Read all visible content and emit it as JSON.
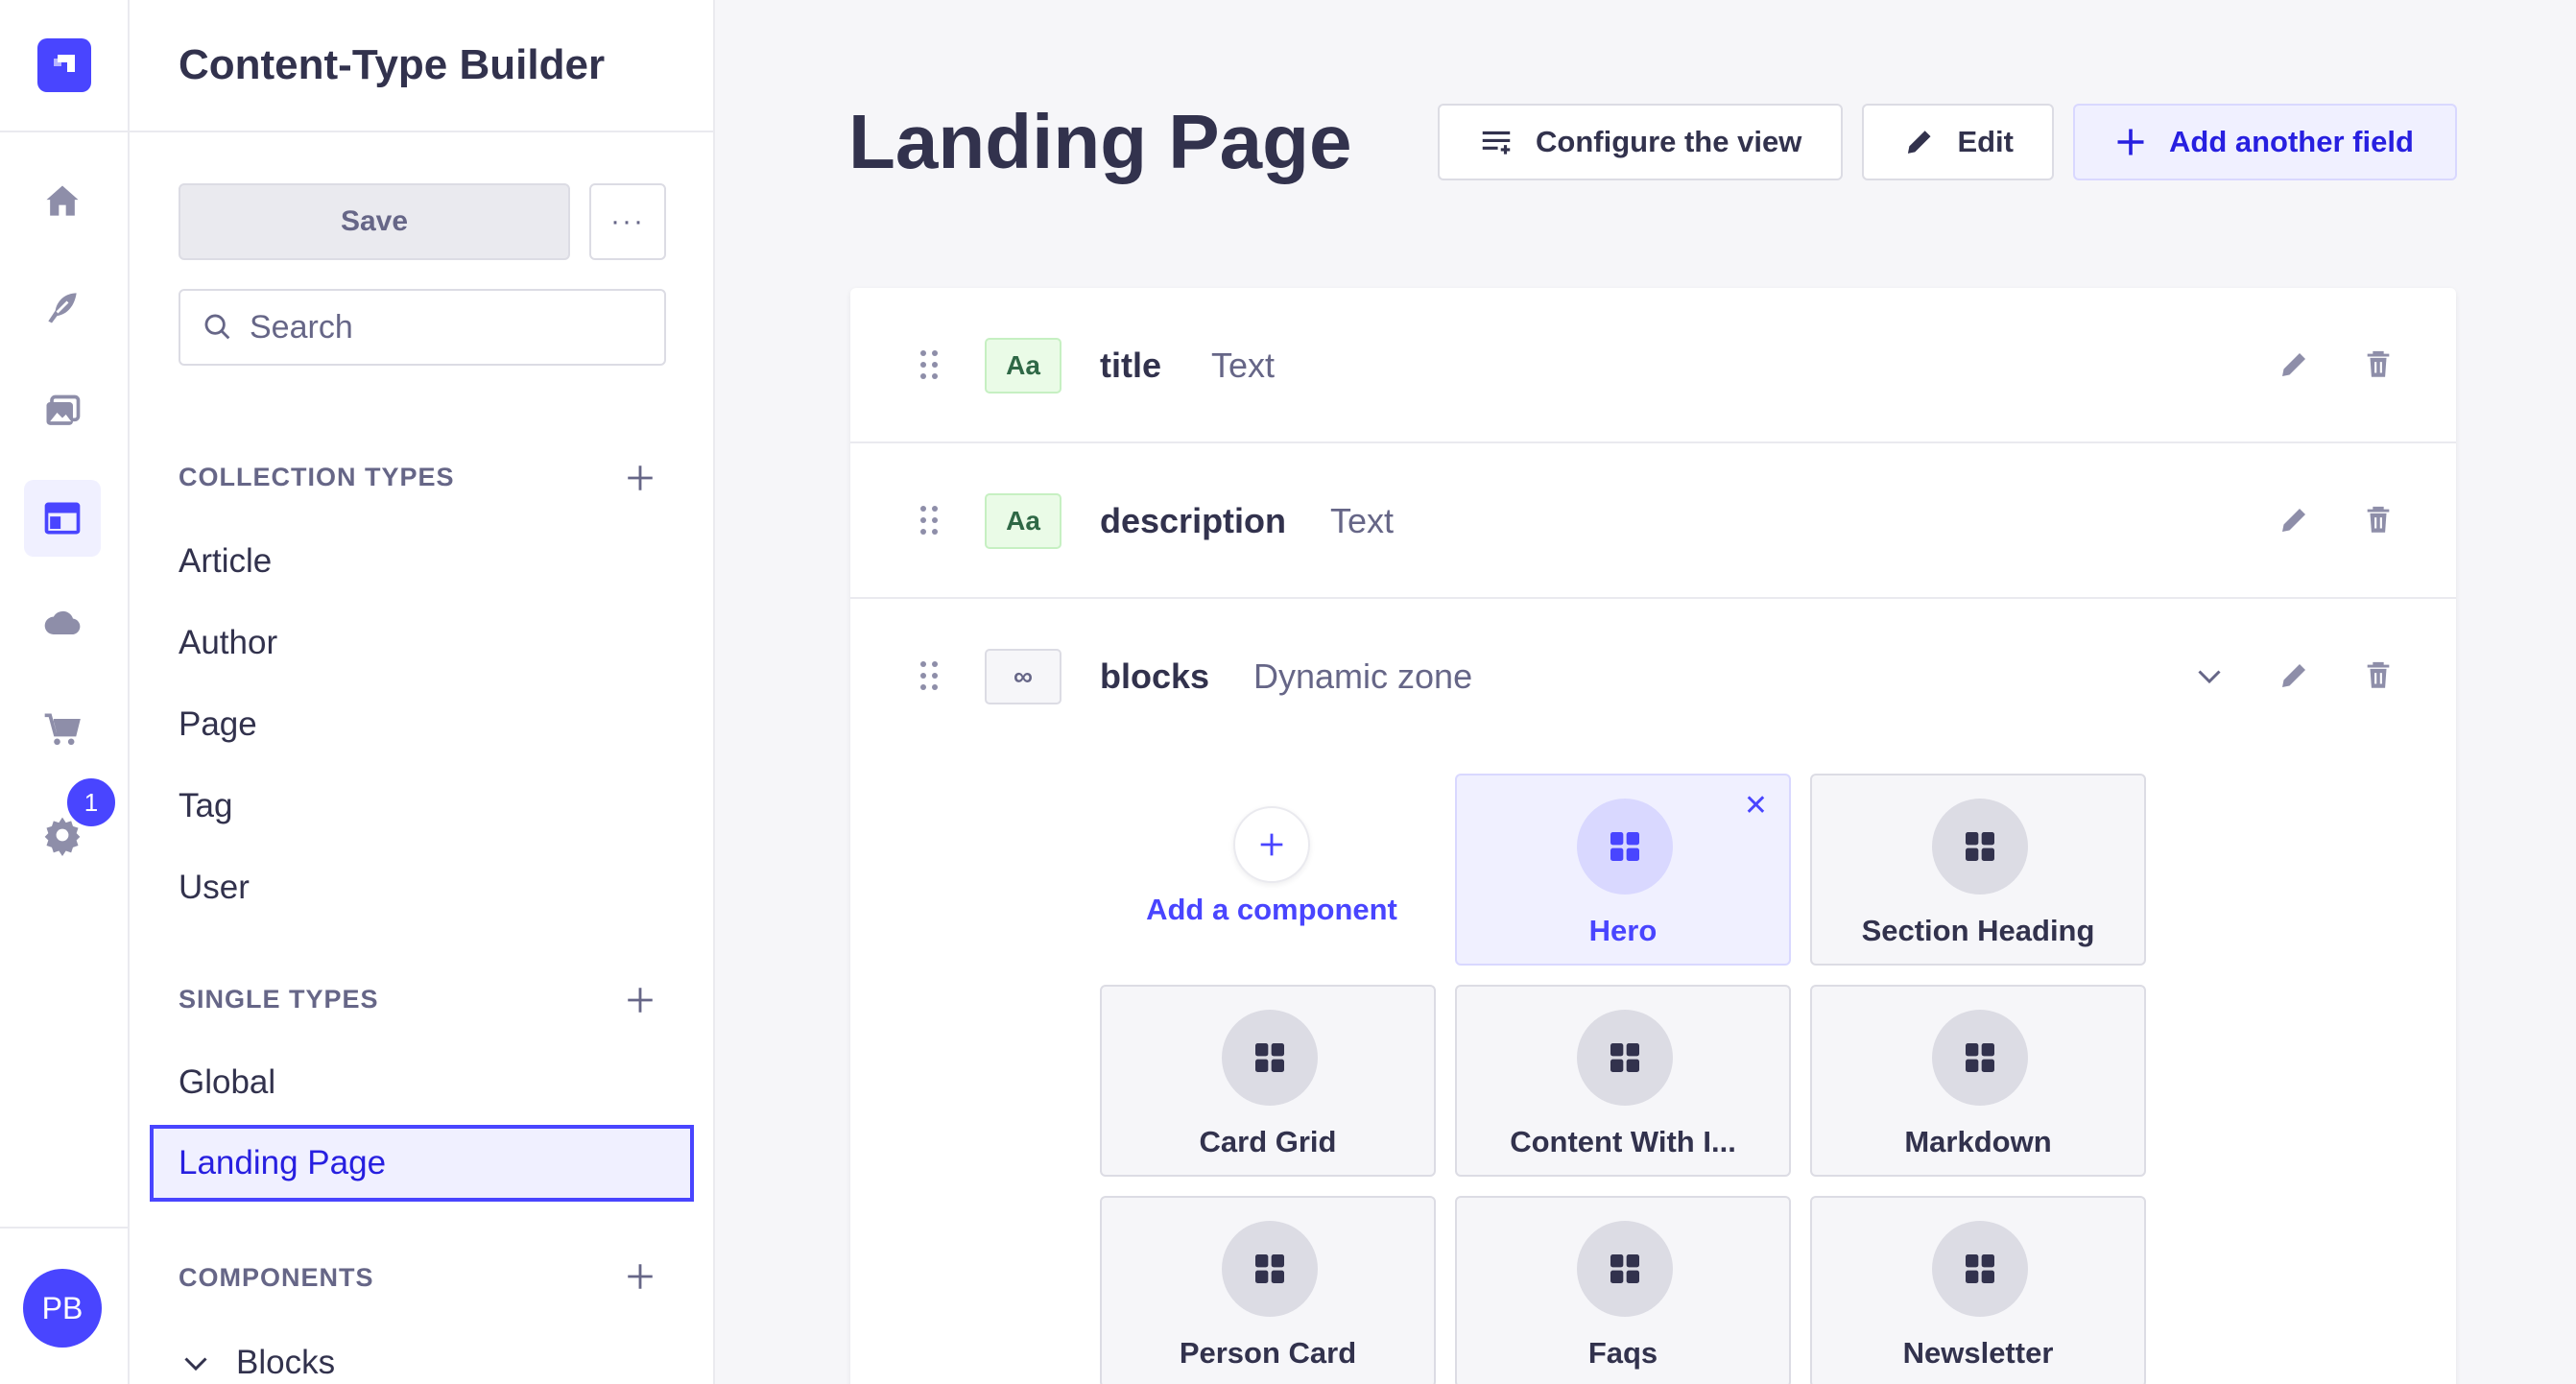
{
  "rail": {
    "badge_count": "1",
    "avatar_initials": "PB",
    "icons": [
      "home-icon",
      "feather-icon",
      "images-icon",
      "layout-icon",
      "cloud-icon",
      "cart-icon",
      "gear-icon"
    ]
  },
  "subnav": {
    "title": "Content-Type Builder",
    "save_label": "Save",
    "more_label": "···",
    "search_placeholder": "Search",
    "collection_types_label": "COLLECTION TYPES",
    "collection_types": [
      "Article",
      "Author",
      "Page",
      "Tag",
      "User"
    ],
    "single_types_label": "SINGLE TYPES",
    "single_types": [
      "Global",
      "Landing Page"
    ],
    "components_label": "COMPONENTS",
    "component_groups": [
      "Blocks"
    ]
  },
  "main": {
    "title": "Landing Page",
    "configure_label": "Configure the view",
    "edit_label": "Edit",
    "add_field_label": "Add another field",
    "fields": [
      {
        "badge": "Aa",
        "name": "title",
        "type": "Text"
      },
      {
        "badge": "Aa",
        "name": "description",
        "type": "Text"
      },
      {
        "badge": "∞",
        "name": "blocks",
        "type": "Dynamic zone"
      }
    ],
    "add_component_label": "Add a component",
    "components": [
      "Hero",
      "Section Heading",
      "Card Grid",
      "Content With I...",
      "Markdown",
      "Person Card",
      "Faqs",
      "Newsletter"
    ]
  },
  "colors": {
    "primary": "#4945ff",
    "primary_light": "#f0f0ff",
    "text": "#32324d",
    "muted": "#666687"
  }
}
